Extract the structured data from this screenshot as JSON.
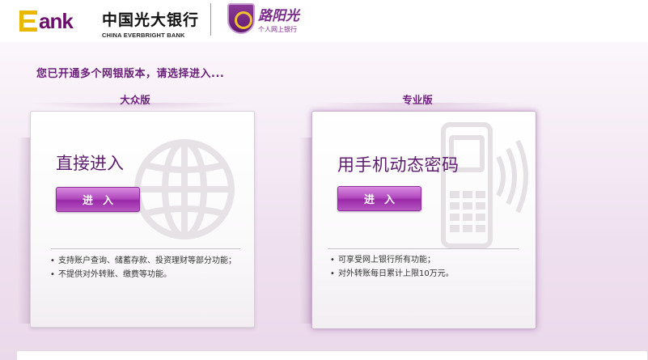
{
  "header": {
    "ebank_logo_text": "ank",
    "ceb_logo_cn": "中国光大银行",
    "ceb_logo_en": "CHINA EVERBRIGHT BANK",
    "sunshine_logo_cn": "路阳光",
    "sunshine_logo_sub": "个人网上银行"
  },
  "notice": "您已开通多个网银版本，请选择进入...",
  "panels": [
    {
      "label": "大众版",
      "card_title": "直接进入",
      "button_label": "进入",
      "features": [
        "支持账户查询、储蓄存款、投资理财等部分功能；",
        "不提供对外转账、缴费等功能。"
      ]
    },
    {
      "label": "专业版",
      "card_title": "用手机动态密码",
      "button_label": "进入",
      "features": [
        "可享受网上银行所有功能；",
        "对外转账每日累计上限10万元。"
      ]
    }
  ],
  "colors": {
    "brand_purple": "#6a1d7a",
    "button_purple": "#b24cbf",
    "ebank_gold": "#e9b800"
  }
}
